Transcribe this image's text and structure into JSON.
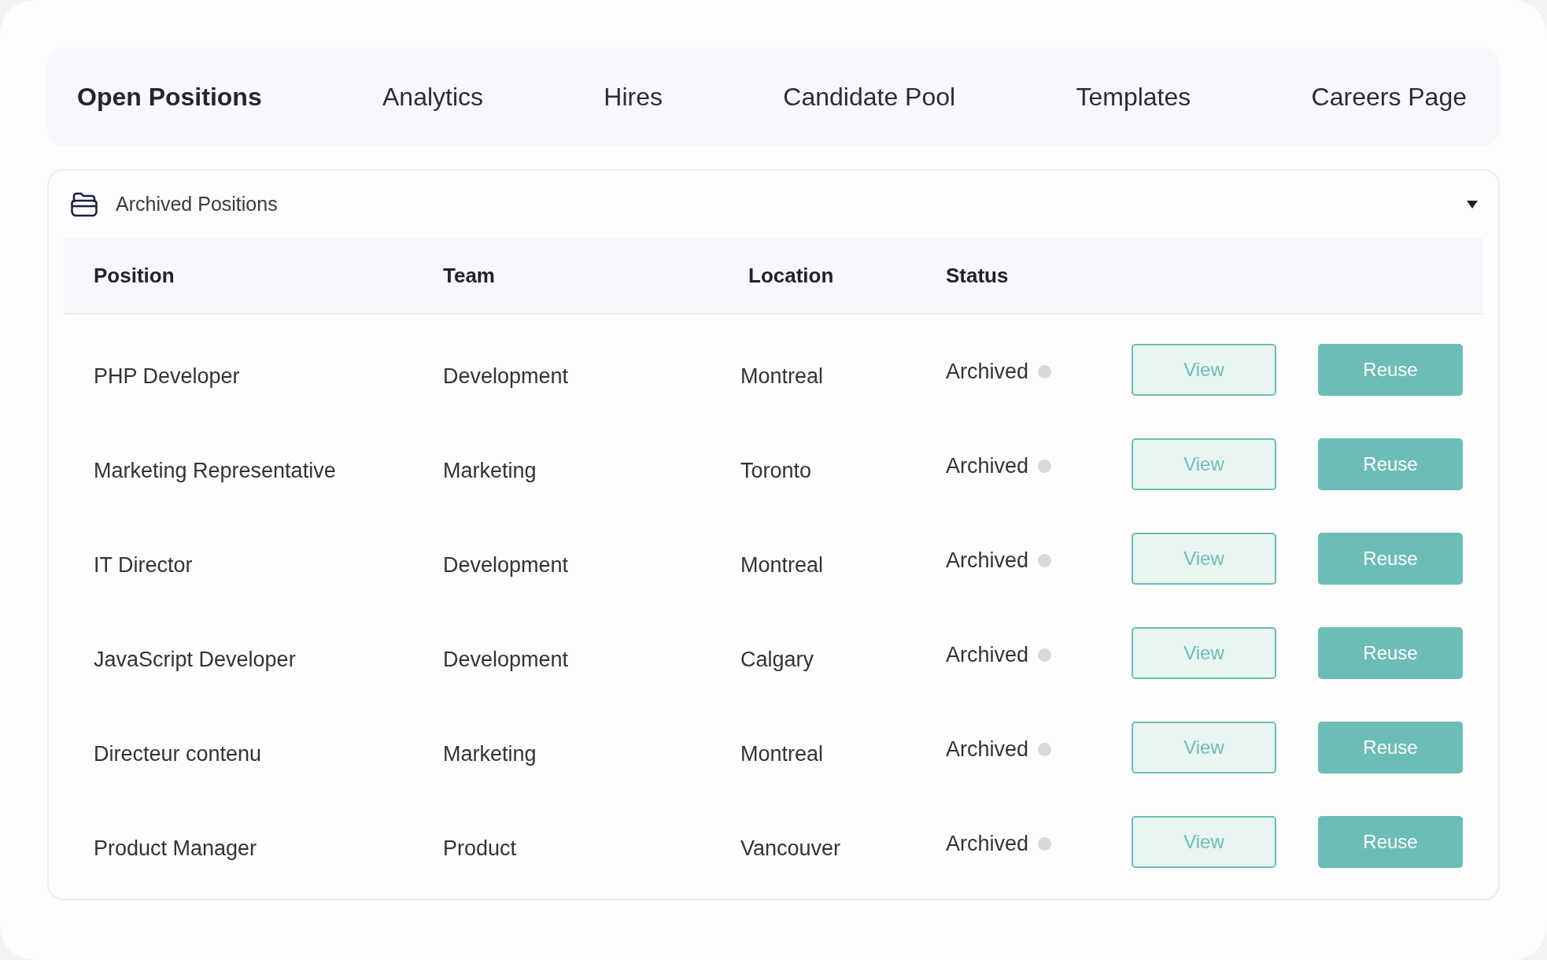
{
  "tabs": [
    {
      "label": "Open Positions",
      "selected": true
    },
    {
      "label": "Analytics",
      "selected": false
    },
    {
      "label": "Hires",
      "selected": false
    },
    {
      "label": "Candidate Pool",
      "selected": false
    },
    {
      "label": "Templates",
      "selected": false
    },
    {
      "label": "Careers Page",
      "selected": false
    }
  ],
  "section": {
    "title": "Archived Positions",
    "expanded": true
  },
  "table": {
    "columns": [
      "Position",
      "Team",
      "Location",
      "Status"
    ],
    "rows": [
      {
        "position": "PHP Developer",
        "team": "Development",
        "location": "Montreal",
        "status": "Archived",
        "actions": [
          {
            "label": "View",
            "kind": "secondary"
          },
          {
            "label": "Reuse",
            "kind": "primary"
          }
        ]
      },
      {
        "position": "Marketing Representative",
        "team": "Marketing",
        "location": "Toronto",
        "status": "Archived",
        "actions": [
          {
            "label": "View",
            "kind": "secondary"
          },
          {
            "label": "Reuse",
            "kind": "primary"
          }
        ]
      },
      {
        "position": "IT Director",
        "team": "Development",
        "location": "Montreal",
        "status": "Archived",
        "actions": [
          {
            "label": "View",
            "kind": "secondary"
          },
          {
            "label": "Reuse",
            "kind": "primary"
          }
        ]
      },
      {
        "position": "JavaScript Developer",
        "team": "Development",
        "location": "Calgary",
        "status": "Archived",
        "actions": [
          {
            "label": "View",
            "kind": "secondary"
          },
          {
            "label": "Reuse",
            "kind": "primary"
          }
        ]
      },
      {
        "position": "Directeur contenu",
        "team": "Marketing",
        "location": "Montreal",
        "status": "Archived",
        "actions": [
          {
            "label": "View",
            "kind": "secondary"
          },
          {
            "label": "Reuse",
            "kind": "primary"
          }
        ]
      },
      {
        "position": "Product Manager",
        "team": "Product",
        "location": "Vancouver",
        "status": "Archived",
        "actions": [
          {
            "label": "View",
            "kind": "secondary"
          },
          {
            "label": "Reuse",
            "kind": "primary"
          }
        ]
      }
    ]
  }
}
